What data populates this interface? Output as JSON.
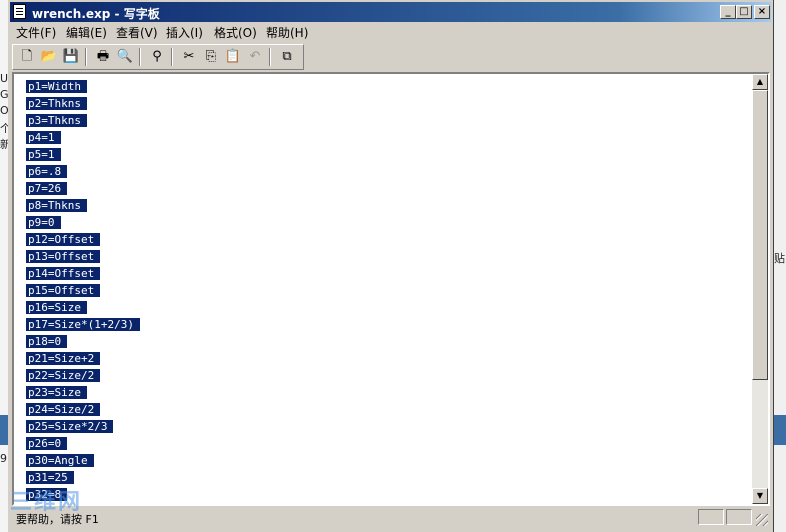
{
  "window": {
    "title": "wrench.exp - 写字板"
  },
  "menu": [
    "文件(F)",
    "编辑(E)",
    "查看(V)",
    "插入(I)",
    "格式(O)",
    "帮助(H)"
  ],
  "toolbar": [
    "new",
    "open",
    "save",
    "print",
    "print-preview",
    "find",
    "cut",
    "copy",
    "paste",
    "undo",
    "insert-object"
  ],
  "document_lines": [
    "p1=Width",
    "p2=Thkns",
    "p3=Thkns",
    "p4=1",
    "p5=1",
    "p6=.8",
    "p7=26",
    "p8=Thkns",
    "p9=0",
    "p12=Offset",
    "p13=Offset",
    "p14=Offset",
    "p15=Offset",
    "p16=Size",
    "p17=Size*(1+2/3)",
    "p18=0",
    "p21=Size+2",
    "p22=Size/2",
    "p23=Size",
    "p24=Size/2",
    "p25=Size*2/3",
    "p26=0",
    "p30=Angle",
    "p31=25",
    "p32=8"
  ],
  "status": {
    "text": "要帮助，请按 F1"
  },
  "background": {
    "left_chars": [
      "U",
      "Gr",
      "O",
      "个",
      "新"
    ],
    "right_char": "贴",
    "left_num": "9"
  },
  "watermark": "三维网",
  "colors": {
    "title_bar": "#0a246a",
    "selection": "#0a246a",
    "chrome": "#d4d0c8"
  }
}
